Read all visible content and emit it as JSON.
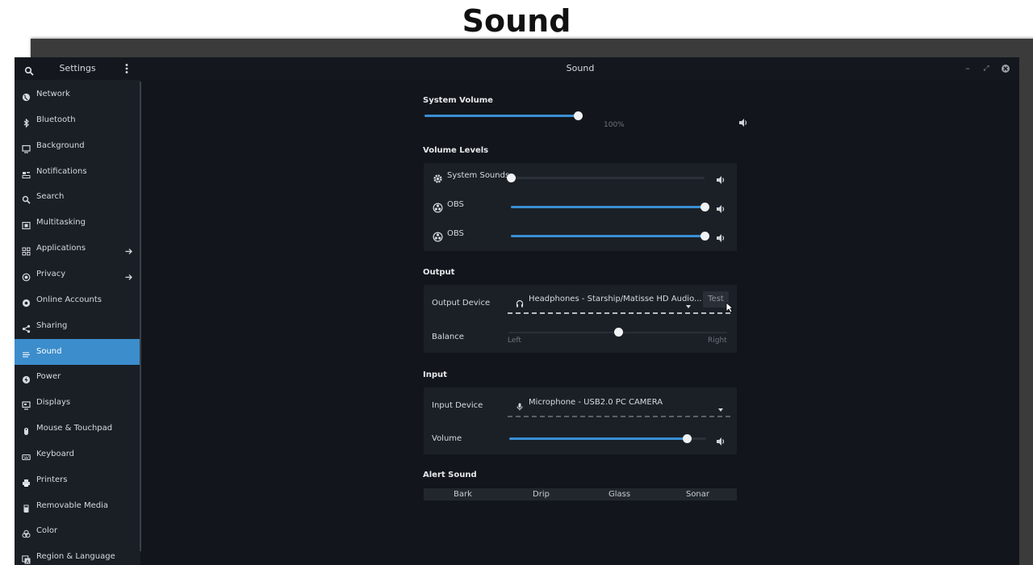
{
  "heading": "Sound",
  "window": {
    "sidebar_title": "Settings",
    "title": "Sound",
    "controls": {
      "minimize": "–",
      "maximize": "⤢",
      "close": "×"
    }
  },
  "sidebar": {
    "items": [
      {
        "label": "Network",
        "icon": "globe-icon",
        "arrow": false,
        "active": false
      },
      {
        "label": "Bluetooth",
        "icon": "bluetooth-icon",
        "arrow": false,
        "active": false
      },
      {
        "label": "Background",
        "icon": "monitor-icon",
        "arrow": false,
        "active": false
      },
      {
        "label": "Notifications",
        "icon": "notifications-icon",
        "arrow": false,
        "active": false
      },
      {
        "label": "Search",
        "icon": "search-icon",
        "arrow": false,
        "active": false
      },
      {
        "label": "Multitasking",
        "icon": "multitasking-icon",
        "arrow": false,
        "active": false
      },
      {
        "label": "Applications",
        "icon": "grid-icon",
        "arrow": true,
        "active": false
      },
      {
        "label": "Privacy",
        "icon": "privacy-icon",
        "arrow": true,
        "active": false
      },
      {
        "label": "Online Accounts",
        "icon": "online-accounts-icon",
        "arrow": false,
        "active": false
      },
      {
        "label": "Sharing",
        "icon": "share-icon",
        "arrow": false,
        "active": false
      },
      {
        "label": "Sound",
        "icon": "speaker-icon",
        "arrow": false,
        "active": true
      },
      {
        "label": "Power",
        "icon": "power-icon",
        "arrow": false,
        "active": false
      },
      {
        "label": "Displays",
        "icon": "display-icon",
        "arrow": false,
        "active": false
      },
      {
        "label": "Mouse & Touchpad",
        "icon": "mouse-icon",
        "arrow": false,
        "active": false
      },
      {
        "label": "Keyboard",
        "icon": "keyboard-icon",
        "arrow": false,
        "active": false
      },
      {
        "label": "Printers",
        "icon": "printer-icon",
        "arrow": false,
        "active": false
      },
      {
        "label": "Removable Media",
        "icon": "usb-icon",
        "arrow": false,
        "active": false
      },
      {
        "label": "Color",
        "icon": "color-icon",
        "arrow": false,
        "active": false
      },
      {
        "label": "Region & Language",
        "icon": "region-icon",
        "arrow": false,
        "active": false
      }
    ]
  },
  "system_volume": {
    "title": "System Volume",
    "value": 0.71,
    "note": "100%"
  },
  "volume_levels": {
    "title": "Volume Levels",
    "rows": [
      {
        "label": "System Sounds",
        "icon": "gear-icon",
        "value": 0.0
      },
      {
        "label": "OBS",
        "icon": "obs-icon",
        "value": 1.0
      },
      {
        "label": "OBS",
        "icon": "obs-icon",
        "value": 1.0
      }
    ]
  },
  "output": {
    "title": "Output",
    "device_label": "Output Device",
    "device_value": "Headphones - Starship/Matisse HD Audio...",
    "test_label": "Test",
    "balance_label": "Balance",
    "balance_value": 0.5,
    "balance_left": "Left",
    "balance_right": "Right"
  },
  "input": {
    "title": "Input",
    "device_label": "Input Device",
    "device_value": "Microphone - USB2.0 PC CAMERA",
    "volume_label": "Volume",
    "volume_value": 0.9
  },
  "alert_sound": {
    "title": "Alert Sound",
    "options": [
      "Bark",
      "Drip",
      "Glass",
      "Sonar"
    ]
  },
  "colors": {
    "accent": "#3c8dcc",
    "slider_fill": "#3a8fd4",
    "sidebar_bg": "#1a1f26",
    "content_bg": "#12161c",
    "panel_bg": "#1b2027"
  }
}
